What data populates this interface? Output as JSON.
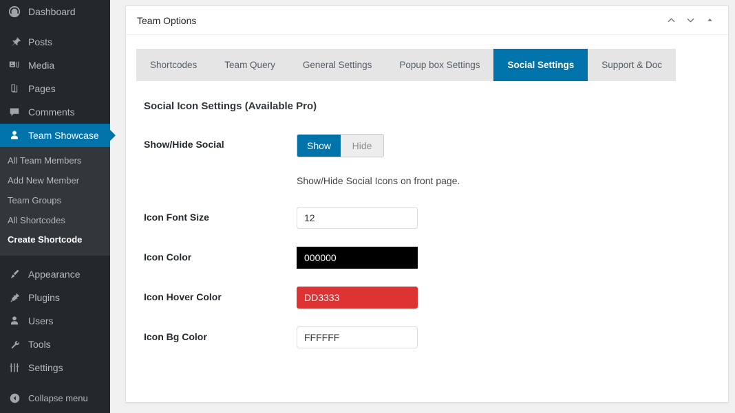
{
  "sidebar": {
    "items": [
      {
        "label": "Dashboard",
        "icon": "dashboard-icon",
        "current": false
      },
      {
        "label": "Posts",
        "icon": "pin-icon",
        "current": false
      },
      {
        "label": "Media",
        "icon": "media-icon",
        "current": false
      },
      {
        "label": "Pages",
        "icon": "pages-icon",
        "current": false
      },
      {
        "label": "Comments",
        "icon": "comment-icon",
        "current": false
      },
      {
        "label": "Team Showcase",
        "icon": "user-icon",
        "current": true
      }
    ],
    "submenu": [
      {
        "label": "All Team Members",
        "current": false
      },
      {
        "label": "Add New Member",
        "current": false
      },
      {
        "label": "Team Groups",
        "current": false
      },
      {
        "label": "All Shortcodes",
        "current": false
      },
      {
        "label": "Create Shortcode",
        "current": true
      }
    ],
    "items_bottom": [
      {
        "label": "Appearance",
        "icon": "brush-icon"
      },
      {
        "label": "Plugins",
        "icon": "plug-icon"
      },
      {
        "label": "Users",
        "icon": "users-icon"
      },
      {
        "label": "Tools",
        "icon": "wrench-icon"
      },
      {
        "label": "Settings",
        "icon": "sliders-icon"
      }
    ],
    "collapse": {
      "label": "Collapse menu",
      "icon": "collapse-arrow-icon"
    },
    "colors": {
      "bg": "#23282d",
      "submenu_bg": "#32373c",
      "current": "#0073aa"
    }
  },
  "panel": {
    "title": "Team Options",
    "header_buttons": [
      {
        "name": "move-up-icon"
      },
      {
        "name": "move-down-icon"
      },
      {
        "name": "toggle-panel-icon"
      }
    ]
  },
  "tabs": [
    {
      "label": "Shortcodes",
      "active": false
    },
    {
      "label": "Team Query",
      "active": false
    },
    {
      "label": "General Settings",
      "active": false
    },
    {
      "label": "Popup box Settings",
      "active": false
    },
    {
      "label": "Social Settings",
      "active": true
    },
    {
      "label": "Support & Doc",
      "active": false
    }
  ],
  "content": {
    "heading": "Social Icon Settings (Available Pro)",
    "show_hide": {
      "label": "Show/Hide Social",
      "option_on": "Show",
      "option_off": "Hide",
      "selected": "Show",
      "help": "Show/Hide Social Icons on front page."
    },
    "fields": [
      {
        "label": "Icon Font Size",
        "value": "12",
        "style": "plain"
      },
      {
        "label": "Icon Color",
        "value": "000000",
        "style": "swatch-dark",
        "color": "#000000"
      },
      {
        "label": "Icon Hover Color",
        "value": "DD3333",
        "style": "swatch-red",
        "color": "#DD3333"
      },
      {
        "label": "Icon Bg Color",
        "value": "FFFFFF",
        "style": "plain",
        "color": "#FFFFFF"
      }
    ]
  }
}
